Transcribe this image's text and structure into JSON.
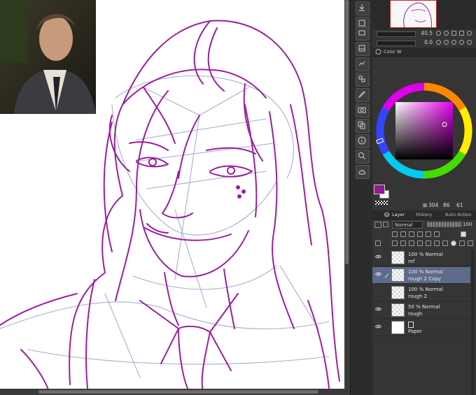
{
  "navigator": {
    "zoom_value": "40.5",
    "rotation_value": "0.0"
  },
  "color_panel": {
    "tab_label": "Color W",
    "hue": "304",
    "saturation": "86",
    "value": "61",
    "main_color": "#8e1a94",
    "sub_color": "#ffffff"
  },
  "layer_panel": {
    "tab_layer": "Layer",
    "tab_history": "History",
    "tab_auto_action": "Auto Action",
    "blend_mode": "Normal",
    "opacity": "100",
    "layers": [
      {
        "mode": "100 % Normal",
        "name": "ref",
        "selected": false
      },
      {
        "mode": "100 % Normal",
        "name": "rough 2 Copy",
        "selected": true
      },
      {
        "mode": "100 % Normal",
        "name": "rough 2",
        "selected": false
      },
      {
        "mode": "50 % Normal",
        "name": "rough",
        "selected": false
      },
      {
        "mode": "",
        "name": "Paper",
        "selected": false
      }
    ]
  },
  "colors": {
    "sketch_stroke": "#9b1fa0",
    "guide_stroke": "#a8aed0",
    "panel_bg": "#353535",
    "selected_layer": "#5e6b8a"
  }
}
